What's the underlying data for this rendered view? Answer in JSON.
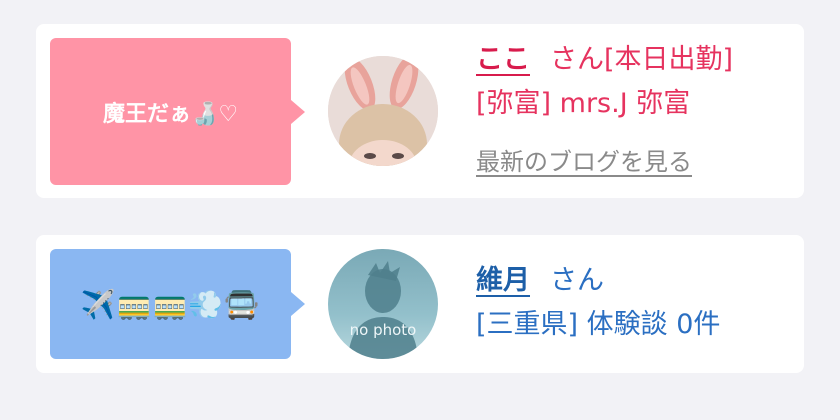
{
  "entries": [
    {
      "message": "魔王だぁ🍶♡",
      "name": "ここ",
      "suffix": "さん[本日出勤]",
      "detail": "[弥富] mrs.J 弥富",
      "link": "最新のブログを見る",
      "bubble_color": "#ff94a6",
      "text_color": "#e6335f",
      "avatar": "bunny-ears-photo"
    },
    {
      "message": "✈️🚃🚃💨🚍",
      "name": "維月",
      "suffix": "さん",
      "detail": "[三重県] 体験談 0件",
      "bubble_color": "#8ab7f2",
      "text_color": "#2b6fc2",
      "avatar_placeholder": "no photo"
    }
  ]
}
